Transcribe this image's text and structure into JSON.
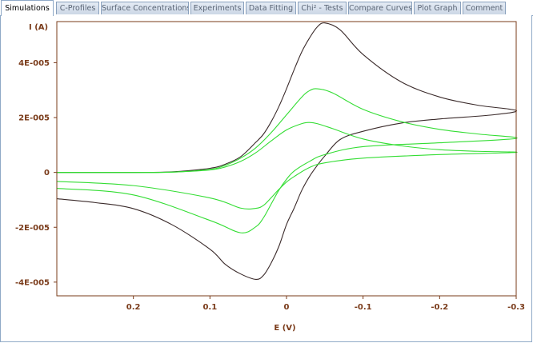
{
  "tabs": [
    {
      "label": "Simulations",
      "active": true
    },
    {
      "label": "C-Profiles",
      "active": false
    },
    {
      "label": "Surface Concentrations",
      "active": false
    },
    {
      "label": "Experiments",
      "active": false
    },
    {
      "label": "Data Fitting",
      "active": false
    },
    {
      "label": "Chi² - Tests",
      "active": false
    },
    {
      "label": "Compare Curves",
      "active": false
    },
    {
      "label": "Plot Graph",
      "active": false
    },
    {
      "label": "Comment",
      "active": false
    }
  ],
  "colors": {
    "axis": "#7a3b1a",
    "label": "#7a3b1a",
    "black_series": "#3a2a2a",
    "green_series": "#33dd33"
  },
  "chart_data": {
    "type": "line",
    "xlabel": "E (V)",
    "ylabel": "I (A)",
    "xlim": [
      0.3,
      -0.3
    ],
    "ylim": [
      -4.5e-05,
      5.5e-05
    ],
    "xticks": [
      {
        "value": 0.2,
        "label": "0.2"
      },
      {
        "value": 0.1,
        "label": "0.1"
      },
      {
        "value": 0,
        "label": "0"
      },
      {
        "value": -0.1,
        "label": "-0.1"
      },
      {
        "value": -0.2,
        "label": "-0.2"
      },
      {
        "value": -0.3,
        "label": "-0.3"
      }
    ],
    "yticks": [
      {
        "value": 4e-05,
        "label": "4E-005"
      },
      {
        "value": 2e-05,
        "label": "2E-005"
      },
      {
        "value": 0,
        "label": "0"
      },
      {
        "value": -2e-05,
        "label": "-2E-005"
      },
      {
        "value": -4e-05,
        "label": "-4E-005"
      }
    ],
    "grid": false,
    "series": [
      {
        "color": "#3a2a2a",
        "x": [
          0.3,
          0.2,
          0.15,
          0.1,
          0.08,
          0.06,
          0.04,
          0.03,
          0.02,
          0.01,
          0,
          -0.01,
          -0.02,
          -0.03,
          -0.04,
          -0.05,
          -0.07,
          -0.1,
          -0.15,
          -0.2,
          -0.25,
          -0.3,
          -0.27,
          -0.2,
          -0.15,
          -0.1,
          -0.07,
          -0.05,
          -0.04,
          -0.03,
          -0.02,
          -0.01,
          0,
          0.01,
          0.02,
          0.03,
          0.04,
          0.06,
          0.08,
          0.1,
          0.15,
          0.2,
          0.25,
          0.3
        ],
        "y": [
          0,
          0,
          2e-07,
          1.5e-06,
          3e-06,
          5.7e-06,
          1.1e-05,
          1.4e-05,
          1.85e-05,
          2.4e-05,
          3.05e-05,
          3.75e-05,
          4.4e-05,
          4.9e-05,
          5.3e-05,
          5.45e-05,
          5.2e-05,
          4.3e-05,
          3.3e-05,
          2.75e-05,
          2.45e-05,
          2.26e-05,
          2.1e-05,
          1.95e-05,
          1.8e-05,
          1.5e-05,
          1.2e-05,
          6e-06,
          2.5e-06,
          -1.5e-06,
          -6.5e-06,
          -1.3e-05,
          -1.9e-05,
          -2.7e-05,
          -3.3e-05,
          -3.75e-05,
          -3.9e-05,
          -3.7e-05,
          -3.35e-05,
          -2.8e-05,
          -1.9e-05,
          -1.32e-05,
          -1.1e-05,
          -9.6e-06
        ]
      },
      {
        "color": "#33dd33",
        "x": [
          0.3,
          0.2,
          0.15,
          0.1,
          0.08,
          0.06,
          0.04,
          0.02,
          0,
          -0.02,
          -0.03,
          -0.04,
          -0.06,
          -0.1,
          -0.15,
          -0.2,
          -0.25,
          -0.3,
          -0.2,
          -0.1,
          -0.05,
          -0.03,
          -0.01,
          0,
          0.01,
          0.02,
          0.03,
          0.04,
          0.06,
          0.1,
          0.2,
          0.3
        ],
        "y": [
          0,
          0,
          1e-07,
          1.1e-06,
          2.6e-06,
          5.2e-06,
          9e-06,
          1.45e-05,
          2.1e-05,
          2.75e-05,
          2.98e-05,
          3.05e-05,
          2.9e-05,
          2.3e-05,
          1.85e-05,
          1.57e-05,
          1.4e-05,
          1.24e-05,
          1.08e-05,
          9.4e-06,
          6.5e-06,
          4e-06,
          5e-07,
          -2.5e-06,
          -6.5e-06,
          -1.15e-05,
          -1.65e-05,
          -1.98e-05,
          -2.2e-05,
          -1.75e-05,
          -8.2e-06,
          -5.8e-06
        ]
      },
      {
        "color": "#33dd33",
        "x": [
          0.3,
          0.2,
          0.15,
          0.1,
          0.08,
          0.06,
          0.04,
          0.02,
          0,
          -0.02,
          -0.03,
          -0.04,
          -0.06,
          -0.1,
          -0.15,
          -0.2,
          -0.25,
          -0.3,
          -0.2,
          -0.1,
          -0.05,
          -0.03,
          -0.01,
          0,
          0.01,
          0.02,
          0.03,
          0.04,
          0.06,
          0.1,
          0.2,
          0.3
        ],
        "y": [
          0,
          0,
          1e-07,
          9e-07,
          2e-06,
          4e-06,
          7.2e-06,
          1.15e-05,
          1.55e-05,
          1.78e-05,
          1.82e-05,
          1.78e-05,
          1.6e-05,
          1.22e-05,
          9.7e-06,
          8.3e-06,
          7.7e-06,
          7.3e-06,
          6.5e-06,
          5.2e-06,
          3.5e-06,
          1.8e-06,
          -1.5e-06,
          -3.5e-06,
          -6.2e-06,
          -9.2e-06,
          -1.2e-05,
          -1.31e-05,
          -1.3e-05,
          -9.3e-06,
          -4.8e-06,
          -3.3e-06
        ]
      }
    ]
  }
}
